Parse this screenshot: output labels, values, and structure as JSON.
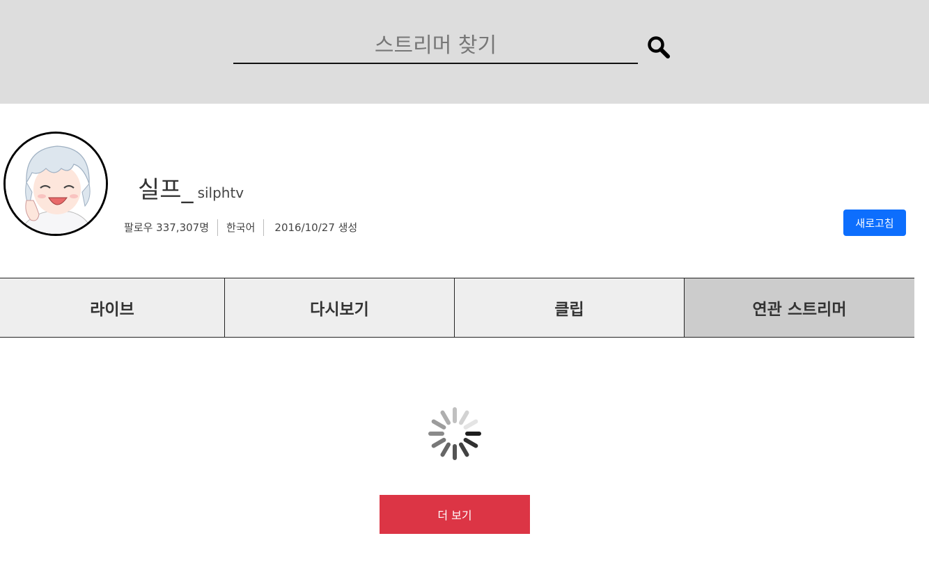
{
  "search": {
    "placeholder": "스트리머 찾기",
    "icon": "search-icon"
  },
  "profile": {
    "display_name": "실프_",
    "login_name": "silphtv",
    "followers": "팔로우 337,307명",
    "language": "한국어",
    "created": "2016/10/27 생성",
    "refresh_label": "새로고침"
  },
  "tabs": [
    {
      "label": "라이브",
      "active": false
    },
    {
      "label": "다시보기",
      "active": false
    },
    {
      "label": "클립",
      "active": false
    },
    {
      "label": "연관 스트리머",
      "active": true
    }
  ],
  "more_label": "더 보기",
  "colors": {
    "refresh": "#0d6efd",
    "more": "#dc3545",
    "header_bg": "#dddddd"
  }
}
